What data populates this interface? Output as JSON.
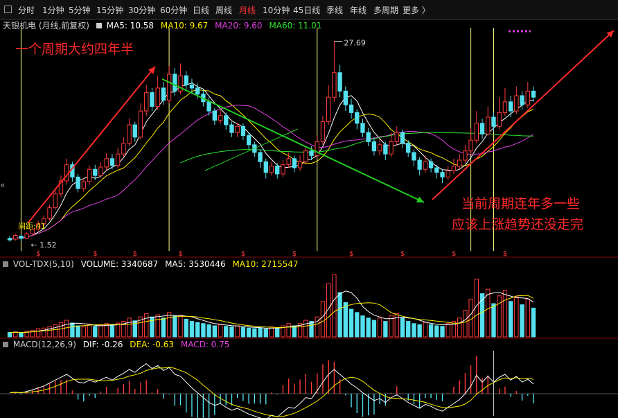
{
  "toolbar": {
    "items": [
      "分时",
      "1分钟",
      "5分钟",
      "15分钟",
      "30分钟",
      "60分钟",
      "日线",
      "周线",
      "月线",
      "10分钟",
      "45日线",
      "季线",
      "年线",
      "多周期",
      "更多 〉"
    ],
    "active_index": 8,
    "active_color": "#ff3030"
  },
  "price_legend": {
    "name": "天银机电 (月线,前复权)",
    "ma5": "MA5: 10.58",
    "ma10": "MA10: 9.67",
    "ma20": "MA20: 9.60",
    "ma60": "MA60: 11.01"
  },
  "vol_legend": {
    "name": "VOL-TDX(5,10)",
    "volume": "VOLUME: 3340687",
    "ma5": "MA5: 3530446",
    "ma10": "MA10: 2715547"
  },
  "macd_legend": {
    "name": "MACD(12,26,9)",
    "dif": "DIF: -0.26",
    "dea": "DEA: -0.63",
    "macd": "MACD: 0.75"
  },
  "annotations": {
    "cycle_note": "一个周期大约四年半",
    "current_note_1": "当前周期连年多一些",
    "current_note_2": "应该上涨趋势还没走完",
    "interval_label": "间距:41",
    "marker_glyph": "$",
    "left_arrow": "«"
  },
  "colors": {
    "up": "#ff3b3b",
    "down": "#54e0ee",
    "ma5": "#ffffff",
    "ma10": "#ffee00",
    "ma20": "#e040e0",
    "ma60": "#2ee82e",
    "cycle_line": "#ffff80",
    "annotation": "#ff2a2a",
    "trend_green": "#22cc22"
  },
  "chart_data": {
    "type": "candlestick",
    "period": "monthly",
    "high_label": "27.69",
    "low_label": "1.52",
    "ylim": [
      1.0,
      29.0
    ],
    "candles": [
      [
        2.0,
        1.8,
        2.3,
        1.6
      ],
      [
        1.9,
        2.4,
        2.6,
        1.7
      ],
      [
        2.3,
        2.0,
        2.5,
        1.52
      ],
      [
        2.0,
        2.6,
        2.8,
        1.9
      ],
      [
        2.6,
        3.2,
        3.5,
        2.4
      ],
      [
        3.2,
        3.9,
        4.3,
        3.0
      ],
      [
        3.9,
        4.6,
        5.0,
        3.6
      ],
      [
        4.6,
        6.0,
        6.4,
        4.3
      ],
      [
        6.0,
        7.8,
        8.2,
        5.7
      ],
      [
        7.8,
        9.5,
        10.2,
        7.4
      ],
      [
        9.5,
        11.6,
        12.4,
        9.0
      ],
      [
        11.6,
        10.0,
        12.0,
        9.4
      ],
      [
        10.0,
        8.5,
        10.4,
        8.0
      ],
      [
        8.5,
        9.4,
        9.9,
        8.1
      ],
      [
        9.4,
        11.0,
        11.5,
        9.0
      ],
      [
        11.0,
        10.2,
        11.6,
        9.6
      ],
      [
        10.2,
        11.3,
        11.9,
        9.9
      ],
      [
        11.3,
        12.4,
        13.1,
        10.9
      ],
      [
        12.4,
        11.5,
        13.0,
        11.0
      ],
      [
        11.5,
        13.0,
        13.8,
        11.1
      ],
      [
        13.0,
        14.4,
        15.2,
        12.6
      ],
      [
        14.4,
        16.8,
        17.6,
        14.0
      ],
      [
        16.8,
        15.2,
        17.2,
        14.6
      ],
      [
        15.2,
        18.6,
        19.6,
        14.9
      ],
      [
        18.6,
        21.0,
        22.0,
        18.0
      ],
      [
        21.0,
        19.2,
        21.6,
        18.6
      ],
      [
        19.2,
        21.6,
        23.2,
        18.8
      ],
      [
        21.6,
        20.0,
        22.4,
        19.4
      ],
      [
        20.0,
        23.4,
        24.5,
        19.6
      ],
      [
        23.4,
        21.2,
        24.2,
        20.6
      ],
      [
        21.2,
        23.2,
        24.8,
        20.8
      ],
      [
        23.2,
        22.0,
        23.8,
        21.4
      ],
      [
        22.0,
        21.6,
        22.8,
        20.8
      ],
      [
        21.6,
        20.8,
        22.2,
        20.2
      ],
      [
        20.8,
        19.8,
        21.4,
        19.2
      ],
      [
        19.8,
        18.6,
        20.4,
        18.0
      ],
      [
        18.6,
        17.4,
        19.0,
        16.8
      ],
      [
        17.4,
        18.0,
        18.8,
        16.9
      ],
      [
        18.0,
        16.8,
        18.4,
        16.2
      ],
      [
        16.8,
        15.8,
        17.2,
        15.2
      ],
      [
        15.8,
        16.6,
        17.0,
        15.2
      ],
      [
        16.6,
        15.4,
        17.0,
        14.8
      ],
      [
        15.4,
        14.2,
        15.8,
        13.6
      ],
      [
        14.2,
        13.2,
        14.6,
        12.6
      ],
      [
        13.2,
        12.0,
        13.6,
        11.2
      ],
      [
        12.0,
        10.6,
        12.4,
        9.8
      ],
      [
        10.6,
        11.4,
        12.0,
        10.2
      ],
      [
        11.4,
        10.4,
        11.8,
        9.8
      ],
      [
        10.4,
        11.6,
        12.2,
        10.0
      ],
      [
        11.6,
        12.4,
        13.2,
        11.2
      ],
      [
        12.4,
        11.2,
        12.8,
        10.6
      ],
      [
        11.2,
        12.0,
        12.8,
        10.8
      ],
      [
        12.0,
        13.4,
        14.0,
        11.6
      ],
      [
        13.4,
        12.8,
        14.0,
        12.2
      ],
      [
        12.8,
        14.6,
        15.4,
        12.4
      ],
      [
        14.6,
        17.2,
        18.0,
        14.2
      ],
      [
        17.2,
        20.4,
        22.0,
        16.8
      ],
      [
        20.4,
        23.6,
        27.69,
        19.8
      ],
      [
        23.6,
        21.2,
        24.6,
        20.4
      ],
      [
        21.2,
        19.4,
        21.8,
        18.6
      ],
      [
        19.4,
        18.4,
        20.2,
        17.6
      ],
      [
        18.4,
        17.0,
        18.8,
        16.2
      ],
      [
        17.0,
        15.8,
        17.6,
        15.2
      ],
      [
        15.8,
        14.6,
        16.4,
        14.0
      ],
      [
        14.6,
        13.4,
        15.2,
        12.8
      ],
      [
        13.4,
        14.2,
        15.0,
        12.8
      ],
      [
        14.2,
        13.0,
        14.6,
        12.2
      ],
      [
        13.0,
        14.6,
        15.8,
        12.6
      ],
      [
        14.6,
        15.8,
        16.6,
        14.2
      ],
      [
        15.8,
        14.4,
        16.2,
        13.8
      ],
      [
        14.4,
        13.2,
        14.8,
        12.6
      ],
      [
        13.2,
        12.2,
        13.6,
        11.4
      ],
      [
        12.2,
        11.0,
        12.6,
        10.2
      ],
      [
        11.0,
        12.0,
        12.8,
        10.6
      ],
      [
        12.0,
        11.2,
        12.4,
        10.6
      ],
      [
        11.2,
        10.6,
        11.6,
        9.8
      ],
      [
        10.6,
        10.0,
        11.0,
        9.2
      ],
      [
        10.0,
        10.8,
        11.4,
        9.6
      ],
      [
        10.8,
        11.4,
        12.4,
        10.4
      ],
      [
        11.4,
        12.2,
        13.0,
        11.0
      ],
      [
        12.2,
        13.4,
        14.2,
        11.8
      ],
      [
        13.4,
        14.8,
        16.4,
        13.0
      ],
      [
        14.8,
        17.0,
        18.6,
        14.4
      ],
      [
        17.0,
        15.6,
        17.6,
        15.0
      ],
      [
        15.6,
        17.8,
        19.2,
        15.4
      ],
      [
        17.8,
        16.6,
        18.4,
        16.0
      ],
      [
        16.6,
        18.4,
        20.4,
        16.2
      ],
      [
        18.4,
        19.8,
        21.6,
        18.0
      ],
      [
        19.8,
        18.6,
        20.6,
        17.8
      ],
      [
        18.6,
        20.6,
        21.8,
        18.2
      ],
      [
        20.6,
        19.4,
        21.2,
        18.8
      ],
      [
        19.4,
        21.2,
        22.4,
        19.0
      ],
      [
        21.2,
        20.4,
        21.8,
        19.8
      ]
    ],
    "cycle_lines": [
      2,
      28,
      54,
      81,
      85
    ],
    "marker_index": [
      5,
      15,
      22,
      30,
      41,
      50,
      60,
      69,
      78,
      87
    ],
    "volume_values": [
      0.8,
      0.9,
      0.7,
      1.0,
      1.2,
      1.5,
      1.6,
      1.9,
      2.2,
      2.6,
      3.0,
      2.5,
      2.0,
      1.8,
      2.2,
      1.9,
      2.1,
      2.4,
      2.0,
      2.5,
      2.8,
      3.4,
      2.9,
      3.6,
      4.2,
      3.6,
      4.0,
      3.4,
      4.4,
      3.8,
      3.9,
      3.2,
      2.8,
      2.6,
      2.4,
      2.2,
      2.0,
      2.2,
      1.9,
      1.8,
      2.0,
      1.7,
      1.6,
      1.5,
      1.6,
      1.4,
      1.8,
      1.6,
      2.0,
      2.4,
      2.0,
      2.4,
      3.0,
      2.8,
      3.6,
      6.4,
      9.6,
      11.2,
      8.0,
      6.2,
      5.0,
      4.4,
      3.8,
      3.4,
      3.0,
      3.4,
      2.8,
      3.8,
      4.2,
      3.4,
      2.8,
      2.4,
      2.2,
      2.6,
      2.2,
      2.0,
      1.9,
      2.4,
      2.8,
      3.4,
      4.8,
      6.8,
      10.4,
      7.8,
      8.6,
      6.0,
      7.4,
      8.4,
      6.4,
      7.2,
      5.8,
      6.8,
      5.2
    ],
    "macd_values": [
      0.05,
      0.08,
      0.04,
      0.12,
      0.2,
      0.3,
      0.4,
      0.55,
      0.7,
      0.85,
      1.0,
      0.8,
      0.6,
      0.55,
      0.7,
      0.6,
      0.72,
      0.85,
      0.7,
      0.9,
      1.05,
      1.25,
      1.1,
      1.35,
      1.55,
      1.3,
      1.45,
      1.2,
      1.35,
      1.0,
      0.9,
      0.6,
      0.3,
      0.05,
      -0.2,
      -0.45,
      -0.6,
      -0.5,
      -0.7,
      -0.85,
      -0.75,
      -0.9,
      -1.05,
      -1.15,
      -1.25,
      -1.35,
      -1.1,
      -1.2,
      -0.95,
      -0.7,
      -0.75,
      -0.5,
      -0.2,
      -0.25,
      0.15,
      0.6,
      1.0,
      1.25,
      1.0,
      0.75,
      0.5,
      0.3,
      0.05,
      -0.15,
      -0.35,
      -0.25,
      -0.45,
      -0.2,
      -0.05,
      -0.25,
      -0.45,
      -0.6,
      -0.75,
      -0.55,
      -0.65,
      -0.8,
      -0.9,
      -0.7,
      -0.5,
      -0.3,
      0.0,
      0.4,
      0.95,
      0.6,
      0.9,
      0.6,
      0.85,
      1.0,
      0.7,
      0.9,
      0.6,
      0.75,
      0.5
    ]
  }
}
